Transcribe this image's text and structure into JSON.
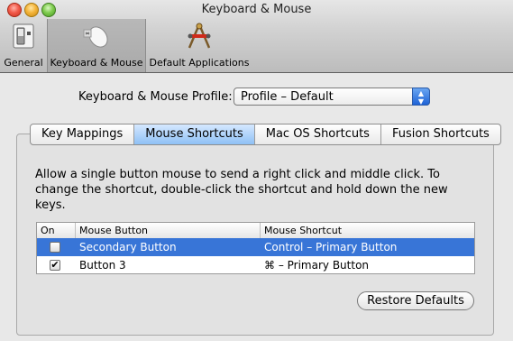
{
  "window": {
    "title": "Keyboard & Mouse"
  },
  "toolbar": {
    "items": [
      {
        "label": "General"
      },
      {
        "label": "Keyboard & Mouse"
      },
      {
        "label": "Default Applications"
      }
    ]
  },
  "profile": {
    "label": "Keyboard & Mouse Profile:",
    "value": "Profile – Default"
  },
  "tabs": [
    {
      "label": "Key Mappings"
    },
    {
      "label": "Mouse Shortcuts"
    },
    {
      "label": "Mac OS Shortcuts"
    },
    {
      "label": "Fusion Shortcuts"
    }
  ],
  "description": "Allow a single button mouse to send a right click and middle click. To change the shortcut, double-click the shortcut and hold down the new keys.",
  "table": {
    "columns": [
      "On",
      "Mouse Button",
      "Mouse Shortcut"
    ],
    "rows": [
      {
        "on": false,
        "button": "Secondary Button",
        "shortcut": "Control – Primary Button"
      },
      {
        "on": true,
        "button": "Button 3",
        "shortcut": "⌘ – Primary Button"
      }
    ]
  },
  "restore_label": "Restore Defaults",
  "colors": {
    "selection": "#3875d7",
    "active_tab": "#8ec0f5"
  }
}
